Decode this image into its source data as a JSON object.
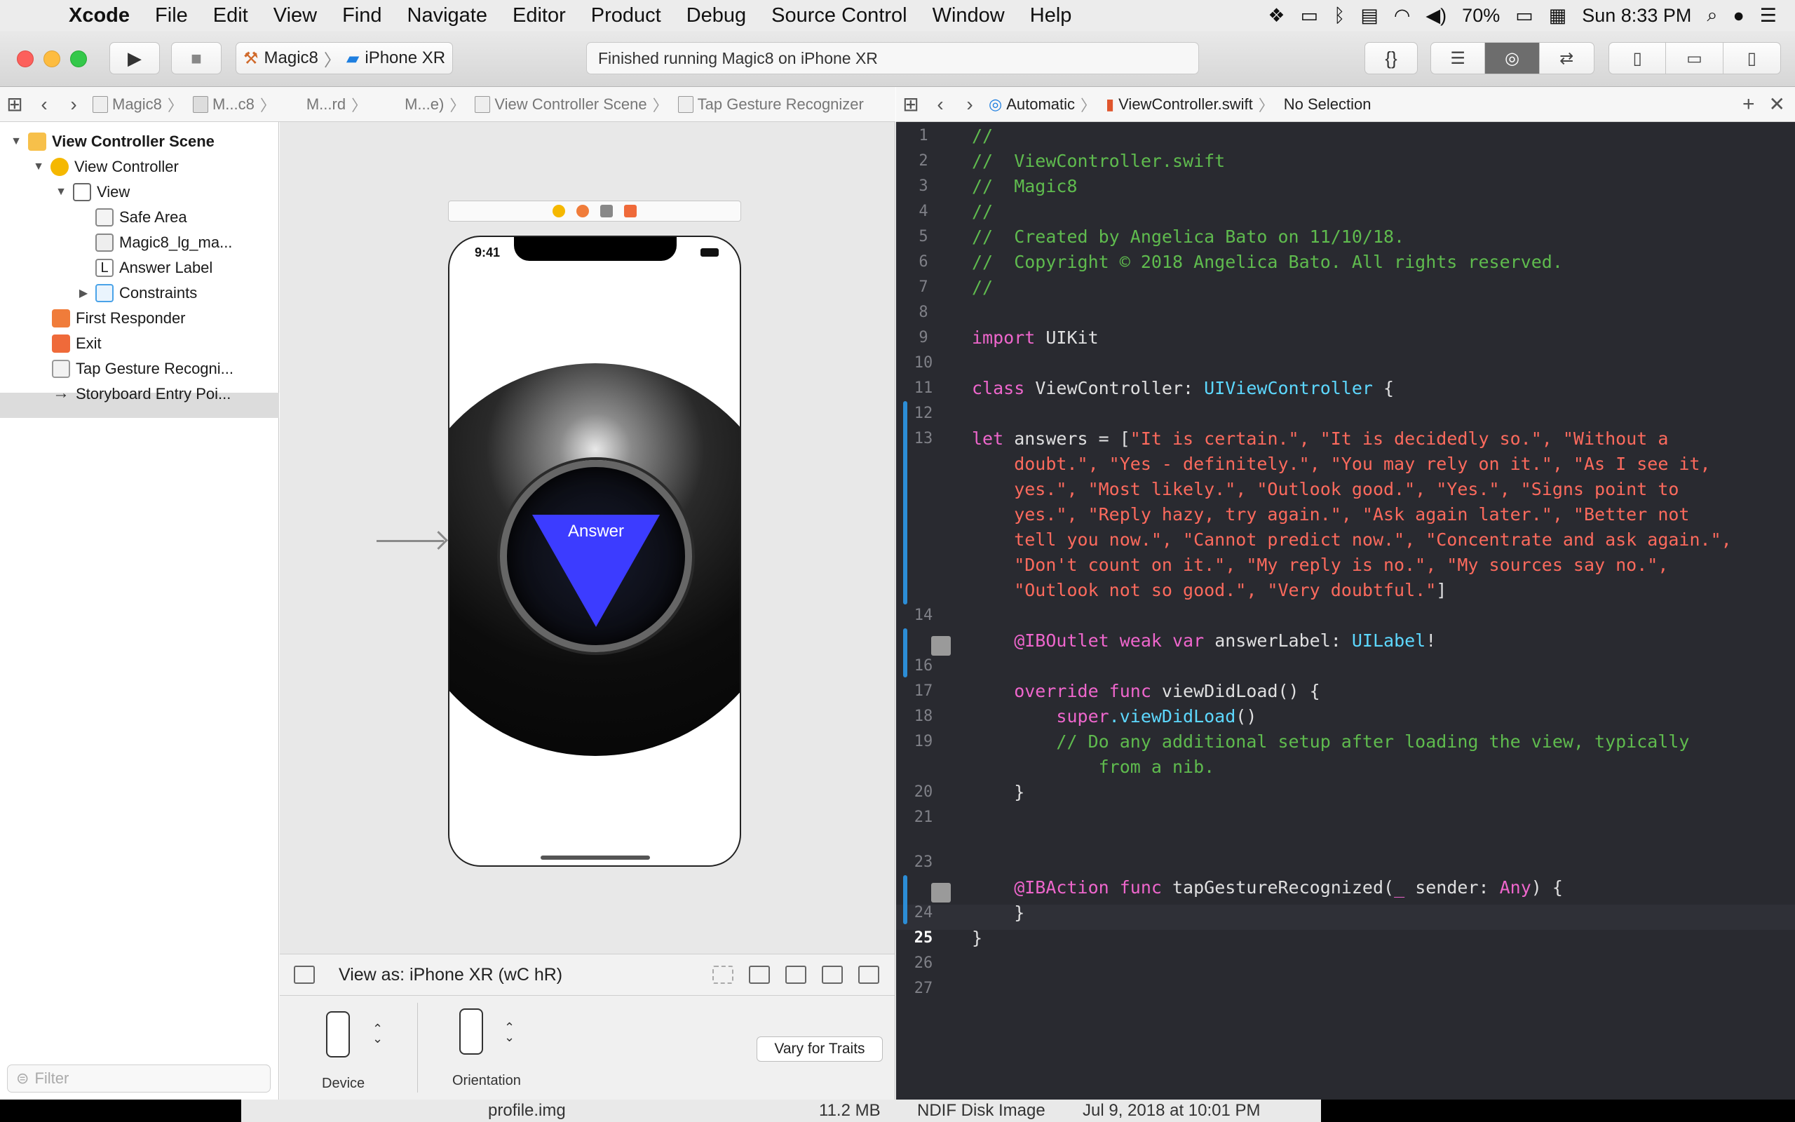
{
  "menubar": {
    "apple_glyph": "",
    "app_name": "Xcode",
    "items": [
      "File",
      "Edit",
      "View",
      "Find",
      "Navigate",
      "Editor",
      "Product",
      "Debug",
      "Source Control",
      "Window",
      "Help"
    ],
    "battery_percent": "70%",
    "clock": "Sun 8:33 PM"
  },
  "toolbar": {
    "scheme_target": "Magic8",
    "scheme_device": "iPhone XR",
    "activity_status": "Finished running Magic8 on iPhone XR",
    "library_button": "{}"
  },
  "ib_jumpbar": {
    "items": [
      "Magic8",
      "M...c8",
      "M...rd",
      "M...e)",
      "View Controller Scene",
      "Tap Gesture Recognizer"
    ]
  },
  "editor_jumpbar": {
    "mode": "Automatic",
    "file": "ViewController.swift",
    "selection": "No Selection"
  },
  "outline": {
    "scene": "View Controller Scene",
    "view_controller": "View Controller",
    "view": "View",
    "safe_area": "Safe Area",
    "image": "Magic8_lg_ma...",
    "label_glyph": "L",
    "answer_label": "Answer Label",
    "constraints": "Constraints",
    "first_responder": "First Responder",
    "exit": "Exit",
    "tap_gesture": "Tap Gesture Recogni...",
    "entry_point": "Storyboard Entry Poi..."
  },
  "filter_placeholder": "Filter",
  "canvas": {
    "phone_time": "9:41",
    "answer_label_text": "Answer",
    "view_as": "View as: iPhone XR (wC hR)",
    "device_label": "Device",
    "orientation_label": "Orientation",
    "vary_for_traits": "Vary for Traits"
  },
  "code": {
    "line_numbers": [
      "1",
      "2",
      "3",
      "4",
      "5",
      "6",
      "7",
      "8",
      "9",
      "10",
      "11",
      "12",
      "13",
      "14",
      "16",
      "17",
      "18",
      "19",
      "20",
      "21",
      "23",
      "24",
      "25",
      "26",
      "27"
    ],
    "l1": "//",
    "l2": "//  ViewController.swift",
    "l3": "//  Magic8",
    "l4": "//",
    "l5": "//  Created by Angelica Bato on 11/10/18.",
    "l6": "//  Copyright © 2018 Angelica Bato. All rights reserved.",
    "l7": "//",
    "l9_kw": "import",
    "l9_mod": " UIKit",
    "l11_kw": "class",
    "l11_name": " ViewController: ",
    "l11_type": "UIViewController",
    "l11_end": " {",
    "l13_kw": "let",
    "l13_name": " answers = [",
    "l13_s1": "\"It is certain.\", \"It is decidedly so.\", \"Without a",
    "l13_s2": "    doubt.\", \"Yes - definitely.\", \"You may rely on it.\", \"As I see it,",
    "l13_s3": "    yes.\", \"Most likely.\", \"Outlook good.\", \"Yes.\", \"Signs point to",
    "l13_s4": "    yes.\", \"Reply hazy, try again.\", \"Ask again later.\", \"Better not",
    "l13_s5": "    tell you now.\", \"Cannot predict now.\", \"Concentrate and ask again.\",",
    "l13_s6": "    \"Don't count on it.\", \"My reply is no.\", \"My sources say no.\",",
    "l13_s7": "    \"Outlook not so good.\", \"Very doubtful.\"",
    "l13_close": "]",
    "l15_attr": "    @IBOutlet weak var",
    "l15_name": " answerLabel: ",
    "l15_type": "UILabel",
    "l15_end": "!",
    "l17_kw": "    override func",
    "l17_name": " viewDidLoad() {",
    "l18_kw": "        super",
    "l18_call": ".viewDidLoad",
    "l18_end": "()",
    "l19a": "        // Do any additional setup after loading the view, typically",
    "l19b": "            from a nib.",
    "l20": "    }",
    "l22_attr": "    @IBAction func",
    "l22_name": " tapGestureRecognized(",
    "l22_us": "_",
    "l22_sender": " sender: ",
    "l22_type": "Any",
    "l22_end": ") {",
    "l24": "    }",
    "l25": "}"
  },
  "finder_peek": {
    "name": "profile.img",
    "size": "11.2 MB",
    "kind": "NDIF Disk Image",
    "date": "Jul 9, 2018 at 10:01 PM"
  },
  "colors": {
    "editor_bg": "#292a30",
    "comment": "#5fbb4e",
    "keyword": "#ee66cc",
    "string": "#fc6a5d",
    "type": "#5dd8ff",
    "triangle": "#3c3cff"
  }
}
